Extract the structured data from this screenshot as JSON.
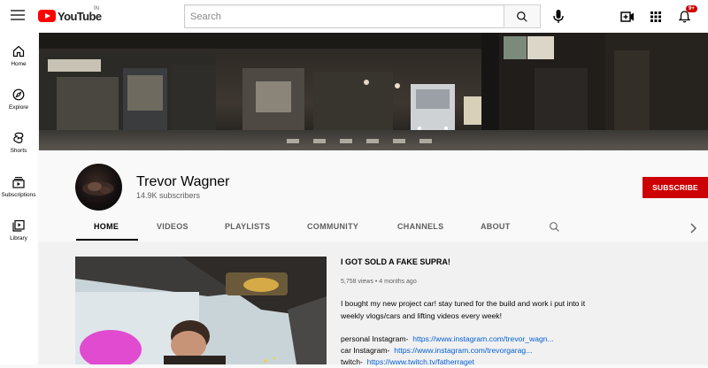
{
  "header": {
    "logo_text": "YouTube",
    "region": "IN",
    "search_placeholder": "Search",
    "notification_count": "9+"
  },
  "sidebar": {
    "items": [
      {
        "label": "Home",
        "icon": "home-icon"
      },
      {
        "label": "Explore",
        "icon": "explore-icon"
      },
      {
        "label": "Shorts",
        "icon": "shorts-icon"
      },
      {
        "label": "Subscriptions",
        "icon": "subscriptions-icon"
      },
      {
        "label": "Library",
        "icon": "library-icon"
      }
    ]
  },
  "channel": {
    "name": "Trevor Wagner",
    "subscribers": "14.9K subscribers",
    "subscribe_label": "SUBSCRIBE"
  },
  "tabs": [
    "HOME",
    "VIDEOS",
    "PLAYLISTS",
    "COMMUNITY",
    "CHANNELS",
    "ABOUT"
  ],
  "featured_video": {
    "title": "I GOT SOLD A FAKE SUPRA!",
    "meta": "5,758 views • 4 months ago",
    "description": "I bought my new project car! stay tuned for the build and work i put into it weekly vlogs/cars and lifting videos every week!",
    "social": [
      {
        "label": "personal Instagram-",
        "link": "https://www.instagram.com/trevor_wagn..."
      },
      {
        "label": "car Instagram-",
        "link": "https://www.instagram.com/trevorgarag..."
      },
      {
        "label": "twitch-",
        "link": "https://www.twitch.tv/fatherraget"
      }
    ]
  },
  "colors": {
    "brand_red": "#ff0000",
    "subscribe_red": "#cc0000",
    "link_blue": "#065fd4"
  }
}
